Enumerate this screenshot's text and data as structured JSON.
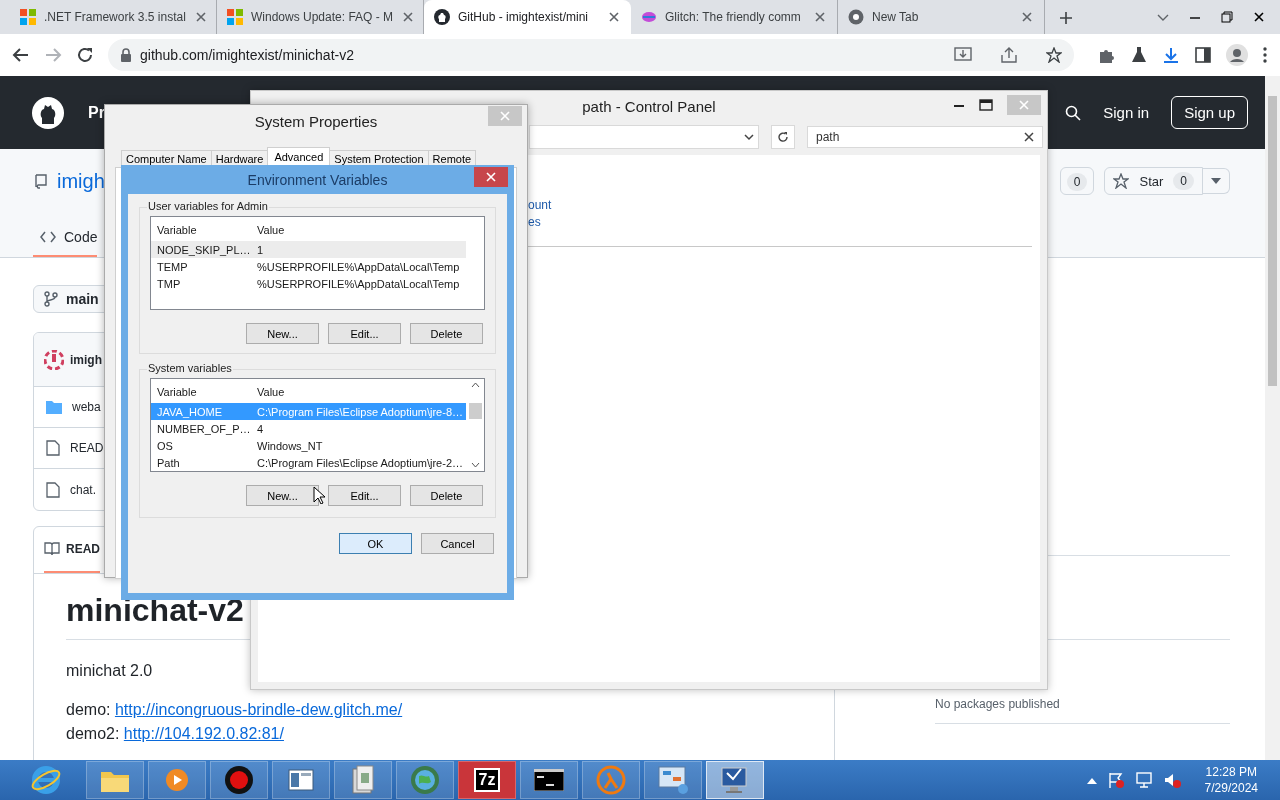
{
  "browser": {
    "tabs": [
      {
        "kind": "windows",
        "title": ".NET Framework 3.5 instal",
        "selected": false
      },
      {
        "kind": "windows",
        "title": "Windows Update: FAQ - M",
        "selected": false
      },
      {
        "kind": "github",
        "title": "GitHub - imightexist/mini",
        "selected": true
      },
      {
        "kind": "glitch",
        "title": "Glitch: The friendly comm",
        "selected": false
      },
      {
        "kind": "chrome",
        "title": "New Tab",
        "selected": false
      }
    ],
    "url": "github.com/imightexist/minichat-v2"
  },
  "github": {
    "header": {
      "nav_partial": "Pr",
      "sign_in": "Sign in",
      "sign_up": "Sign up"
    },
    "repo_title": "imigh",
    "tab": "Code",
    "watch_count": "0",
    "star_label": "Star",
    "star_count": "0",
    "branch": "main",
    "files_header": "imigh",
    "files": [
      {
        "kind": "folder",
        "name": "weba"
      },
      {
        "kind": "file",
        "name": "READ"
      },
      {
        "kind": "file",
        "name": "chat."
      }
    ],
    "readme_tab": "READ",
    "readme": {
      "title": "minichat-v2",
      "description": "minichat 2.0",
      "links": [
        {
          "label": "demo:",
          "url": "http://incongruous-brindle-dew.glitch.me/"
        },
        {
          "label": "demo2:",
          "url": "http://104.192.0.82:81/"
        }
      ]
    },
    "sidebar": {
      "packages": "No packages published"
    }
  },
  "control_panel": {
    "title": "path - Control Panel",
    "search": "path",
    "links": [
      "ount",
      "es"
    ]
  },
  "system_properties": {
    "title": "System Properties",
    "tabs": [
      {
        "label": "Computer Name",
        "selected": false
      },
      {
        "label": "Hardware",
        "selected": false
      },
      {
        "label": "Advanced",
        "selected": true
      },
      {
        "label": "System Protection",
        "selected": false
      },
      {
        "label": "Remote",
        "selected": false
      }
    ]
  },
  "environment_variables": {
    "title": "Environment Variables",
    "user_group": "User variables for Admin",
    "user_list": {
      "focused": false,
      "columns": [
        "Variable",
        "Value"
      ],
      "rows": [
        {
          "variable": "NODE_SKIP_PL…",
          "value": "1",
          "selected": true
        },
        {
          "variable": "TEMP",
          "value": "%USERPROFILE%\\AppData\\Local\\Temp",
          "selected": false
        },
        {
          "variable": "TMP",
          "value": "%USERPROFILE%\\AppData\\Local\\Temp",
          "selected": false
        }
      ]
    },
    "user_buttons": [
      "New...",
      "Edit...",
      "Delete"
    ],
    "system_group": "System variables",
    "system_list": {
      "focused": true,
      "columns": [
        "Variable",
        "Value"
      ],
      "rows": [
        {
          "variable": "JAVA_HOME",
          "value": "C:\\Program Files\\Eclipse Adoptium\\jre-8…",
          "selected": true
        },
        {
          "variable": "NUMBER_OF_P…",
          "value": "4",
          "selected": false
        },
        {
          "variable": "OS",
          "value": "Windows_NT",
          "selected": false
        },
        {
          "variable": "Path",
          "value": "C:\\Program Files\\Eclipse Adoptium\\jre-2…",
          "selected": false
        }
      ]
    },
    "system_buttons": [
      "New...",
      "Edit...",
      "Delete"
    ],
    "buttons": [
      {
        "label": "OK",
        "default": true
      },
      {
        "label": "Cancel",
        "default": false
      }
    ]
  },
  "taskbar": {
    "apps": [
      {
        "kind": "ie",
        "active": false
      },
      {
        "kind": "folder",
        "active": false
      },
      {
        "kind": "media",
        "active": false
      },
      {
        "kind": "record",
        "active": false
      },
      {
        "kind": "window",
        "active": false
      },
      {
        "kind": "archive",
        "active": false
      },
      {
        "kind": "globe",
        "active": false
      },
      {
        "kind": "sevenzip",
        "label": "7z",
        "active": false
      },
      {
        "kind": "terminal",
        "active": false
      },
      {
        "kind": "lambda",
        "active": false
      },
      {
        "kind": "control",
        "active": false
      },
      {
        "kind": "system",
        "active": true
      }
    ],
    "clock": {
      "time": "12:28 PM",
      "date": "7/29/2024"
    }
  }
}
